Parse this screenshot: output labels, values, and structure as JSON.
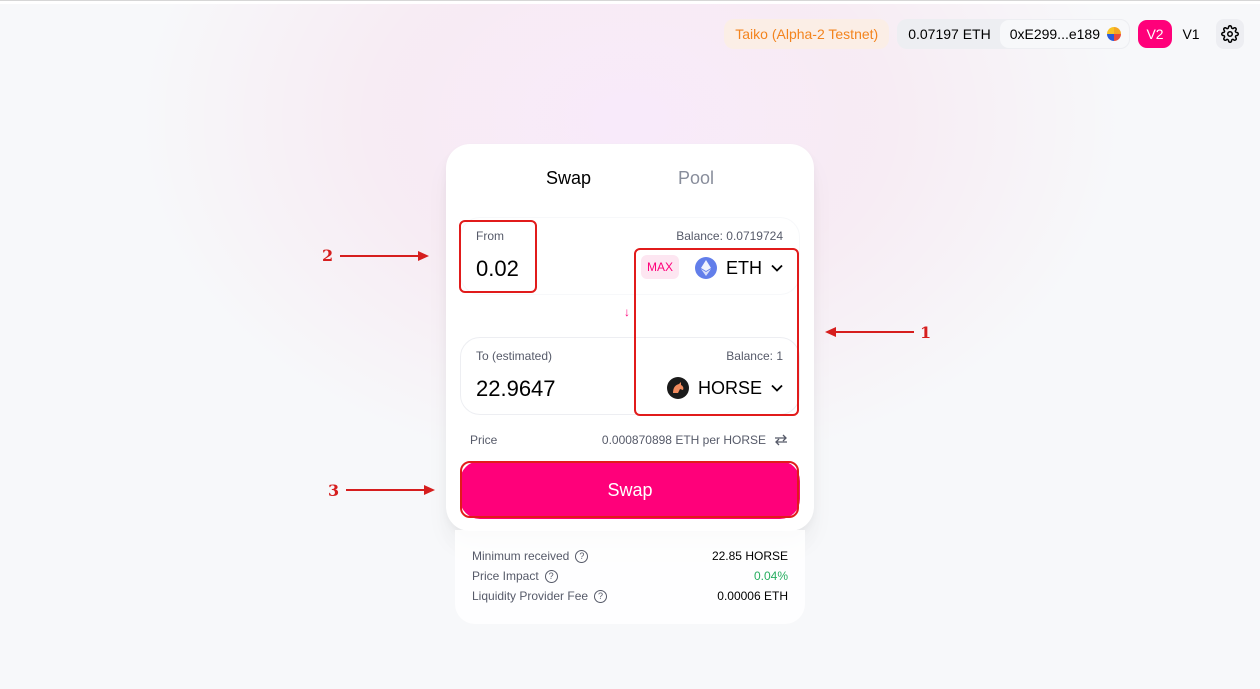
{
  "header": {
    "network_label": "Taiko (Alpha-2 Testnet)",
    "eth_balance": "0.07197 ETH",
    "address": "0xE299...e189",
    "versions": [
      "V2",
      "V1"
    ],
    "settings_icon": "gear-icon"
  },
  "tabs": [
    "Swap",
    "Pool"
  ],
  "from": {
    "label": "From",
    "balance": "Balance: 0.0719724",
    "amount": "0.02",
    "max_label": "MAX",
    "token_symbol": "ETH",
    "token_icon": "eth-icon"
  },
  "to": {
    "label": "To (estimated)",
    "balance": "Balance: 1",
    "amount": "22.9647",
    "token_symbol": "HORSE",
    "token_icon": "horse-icon"
  },
  "arrow_icon": "arrow-down-icon",
  "price": {
    "label": "Price",
    "value": "0.000870898 ETH per HORSE",
    "icon": "swap-rate-icon"
  },
  "swap_button_label": "Swap",
  "details": [
    {
      "label": "Minimum received",
      "value": "22.85 HORSE"
    },
    {
      "label": "Price Impact",
      "value": "0.04%"
    },
    {
      "label": "Liquidity Provider Fee",
      "value": "0.00006 ETH"
    }
  ],
  "annotations": [
    "1",
    "2",
    "3"
  ],
  "colors": {
    "accent": "#ff007a",
    "network_text": "#f3841e",
    "network_bg": "#fbeee6",
    "annotation": "#e11b1b",
    "price_impact": "#27ae60"
  }
}
